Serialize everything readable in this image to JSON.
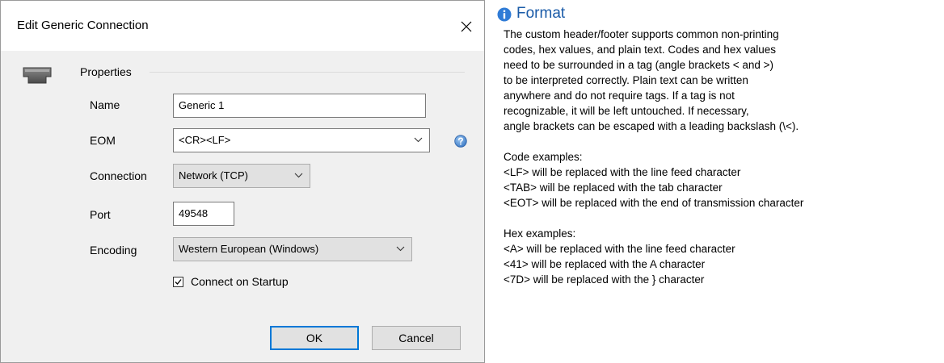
{
  "dialog": {
    "title": "Edit Generic Connection",
    "section_label": "Properties",
    "fields": {
      "name": {
        "label": "Name",
        "value": "Generic 1"
      },
      "eom": {
        "label": "EOM",
        "value": "<CR><LF>"
      },
      "connection": {
        "label": "Connection",
        "value": "Network (TCP)"
      },
      "port": {
        "label": "Port",
        "value": "49548"
      },
      "encoding": {
        "label": "Encoding",
        "value": "Western European (Windows)"
      }
    },
    "connect_on_startup": {
      "label": "Connect on Startup",
      "checked": true
    },
    "buttons": {
      "ok": "OK",
      "cancel": "Cancel"
    },
    "icons": {
      "close": "close-icon",
      "section": "network-port-icon",
      "help": "question-mark-icon",
      "dropdown": "chevron-down-icon",
      "check": "checkmark-icon"
    }
  },
  "help": {
    "title": "Format",
    "icon": "info-icon",
    "intro": [
      "The custom header/footer supports common non-printing",
      "codes, hex values, and plain text. Codes and hex values",
      "need to be surrounded in a tag (angle brackets < and >)",
      "to be interpreted correctly. Plain text can be written",
      "anywhere and do not require tags. If a tag is not",
      "recognizable, it will be left untouched. If necessary,",
      "angle brackets can be escaped with a leading backslash (\\<)."
    ],
    "code_heading": "Code examples:",
    "code_examples": [
      "<LF> will be replaced with the line feed character",
      "<TAB> will be replaced with the tab character",
      "<EOT> will be replaced with the end of transmission character"
    ],
    "hex_heading": "Hex examples:",
    "hex_examples": [
      "<A> will be replaced with the line feed character",
      "<41> will be replaced with the A character",
      "<7D> will be replaced with the } character"
    ]
  },
  "colors": {
    "accent": "#0078d7",
    "dialog_bg": "#f0f0f0",
    "help_title": "#1a5ba8",
    "help_icon": "#2f7bd6"
  }
}
